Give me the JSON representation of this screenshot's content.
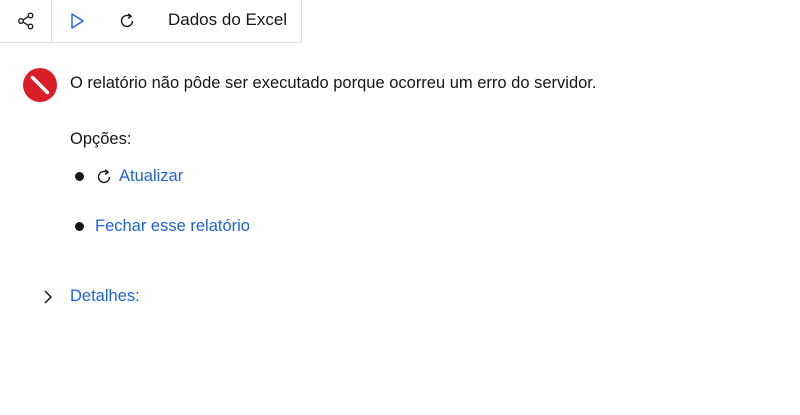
{
  "toolbar": {
    "share_icon": "share-icon",
    "run_icon": "play-icon",
    "refresh_icon": "refresh-icon",
    "title": "Dados do Excel"
  },
  "error": {
    "icon": "error-blocked-icon",
    "color": "#da1e28",
    "message": "O relatório não pôde ser executado porque ocorreu um erro do servidor."
  },
  "options": {
    "label": "Opções:",
    "items": [
      {
        "icon": "refresh-icon",
        "label": "Atualizar"
      },
      {
        "label": "Fechar esse relatório"
      }
    ]
  },
  "details": {
    "icon": "chevron-right-icon",
    "label": "Detalhes:"
  },
  "colors": {
    "link": "#1f63d6",
    "text": "#161616",
    "accent_play": "#1f63d6"
  }
}
